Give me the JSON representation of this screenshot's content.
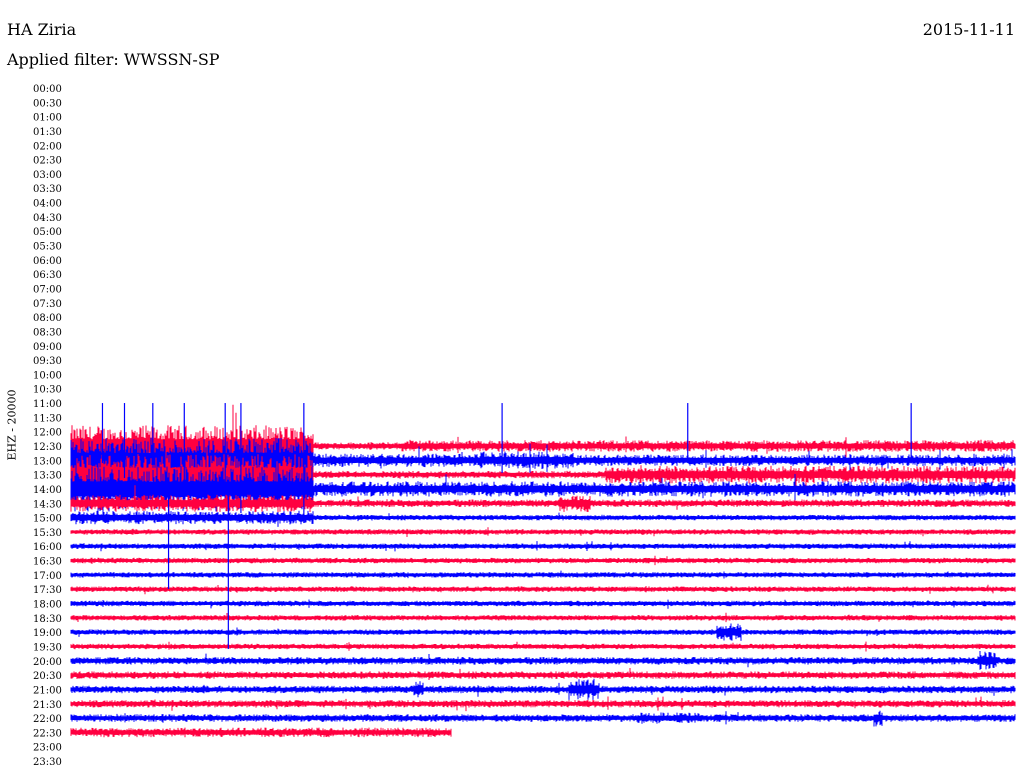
{
  "header": {
    "station": "HA Ziria",
    "filter": "Applied filter: WWSSN-SP",
    "date": "2015-11-11"
  },
  "chart_data": {
    "type": "line",
    "title": "HA Ziria",
    "ylabel": "EHZ - 20000",
    "row_minutes": 30,
    "row_labels": [
      "00:00",
      "00:30",
      "01:00",
      "01:30",
      "02:00",
      "02:30",
      "03:00",
      "03:30",
      "04:00",
      "04:30",
      "05:00",
      "05:30",
      "06:00",
      "06:30",
      "07:00",
      "07:30",
      "08:00",
      "08:30",
      "09:00",
      "09:30",
      "10:00",
      "10:30",
      "11:00",
      "11:30",
      "12:00",
      "12:30",
      "13:00",
      "13:30",
      "14:00",
      "14:30",
      "15:00",
      "15:30",
      "16:00",
      "16:30",
      "17:00",
      "17:30",
      "18:00",
      "18:30",
      "19:00",
      "19:30",
      "20:00",
      "20:30",
      "21:00",
      "21:30",
      "22:00",
      "22:30",
      "23:00",
      "23:30"
    ],
    "colors": {
      "even": "#0000ff",
      "odd": "#ff0040"
    },
    "traces": [
      {
        "row": "12:30",
        "start_min": 0,
        "end_min": 30,
        "noise": 3,
        "burst": [
          [
            0,
            7.7,
            20
          ],
          [
            7.7,
            10.5,
            3
          ],
          [
            10.5,
            30,
            5
          ]
        ]
      },
      {
        "row": "13:00",
        "start_min": 0,
        "end_min": 30,
        "noise": 5,
        "burst": [
          [
            0,
            7.7,
            22
          ],
          [
            7.7,
            13,
            6
          ],
          [
            13,
            16,
            8
          ],
          [
            16,
            30,
            5
          ]
        ]
      },
      {
        "row": "13:30",
        "start_min": 0,
        "end_min": 30,
        "noise": 3,
        "burst": [
          [
            0,
            7.7,
            20
          ],
          [
            17,
            30,
            8
          ]
        ]
      },
      {
        "row": "14:00",
        "start_min": 0,
        "end_min": 30,
        "noise": 5,
        "burst": [
          [
            0,
            7.7,
            22
          ],
          [
            7.7,
            30,
            7
          ]
        ]
      },
      {
        "row": "14:30",
        "start_min": 0,
        "end_min": 30,
        "noise": 3,
        "burst": [
          [
            0,
            7.7,
            8
          ],
          [
            15.5,
            16.5,
            8
          ]
        ]
      },
      {
        "row": "15:00",
        "start_min": 0,
        "end_min": 30,
        "noise": 2,
        "burst": [
          [
            0,
            7.7,
            6
          ]
        ]
      },
      {
        "row": "15:30",
        "start_min": 0,
        "end_min": 30,
        "noise": 2
      },
      {
        "row": "16:00",
        "start_min": 0,
        "end_min": 30,
        "noise": 2
      },
      {
        "row": "16:30",
        "start_min": 0,
        "end_min": 30,
        "noise": 2
      },
      {
        "row": "17:00",
        "start_min": 0,
        "end_min": 30,
        "noise": 2
      },
      {
        "row": "17:30",
        "start_min": 0,
        "end_min": 30,
        "noise": 2
      },
      {
        "row": "18:00",
        "start_min": 0,
        "end_min": 30,
        "noise": 2
      },
      {
        "row": "18:30",
        "start_min": 0,
        "end_min": 30,
        "noise": 2
      },
      {
        "row": "19:00",
        "start_min": 0,
        "end_min": 30,
        "noise": 2,
        "burst": [
          [
            20.5,
            21.3,
            8
          ]
        ]
      },
      {
        "row": "19:30",
        "start_min": 0,
        "end_min": 30,
        "noise": 2
      },
      {
        "row": "20:00",
        "start_min": 0,
        "end_min": 30,
        "noise": 3,
        "burst": [
          [
            28.8,
            29.4,
            9
          ]
        ]
      },
      {
        "row": "20:30",
        "start_min": 0,
        "end_min": 30,
        "noise": 3
      },
      {
        "row": "21:00",
        "start_min": 0,
        "end_min": 30,
        "noise": 3,
        "burst": [
          [
            15.8,
            16.8,
            10
          ],
          [
            10.9,
            11.2,
            8
          ]
        ]
      },
      {
        "row": "21:30",
        "start_min": 0,
        "end_min": 30,
        "noise": 3
      },
      {
        "row": "22:00",
        "start_min": 0,
        "end_min": 30,
        "noise": 3,
        "burst": [
          [
            18,
            20,
            5
          ],
          [
            25.5,
            25.8,
            8
          ]
        ]
      },
      {
        "row": "22:30",
        "start_min": 0,
        "end_min": 12.1,
        "noise": 4
      }
    ],
    "spikes": [
      {
        "row": "11:00",
        "min": 1.0,
        "amp": 60
      },
      {
        "row": "11:00",
        "min": 1.7,
        "amp": 75
      },
      {
        "row": "11:00",
        "min": 3.6,
        "amp": 95
      },
      {
        "row": "11:00",
        "min": 4.9,
        "amp": 80
      },
      {
        "row": "11:00",
        "min": 5.4,
        "amp": 110
      },
      {
        "row": "11:00",
        "min": 7.4,
        "amp": 120
      },
      {
        "row": "11:00",
        "min": 2.6,
        "amp": 50
      },
      {
        "row": "11:00",
        "min": 13.7,
        "amp": 70
      },
      {
        "row": "11:00",
        "min": 19.6,
        "amp": 60
      },
      {
        "row": "11:00",
        "min": 26.7,
        "amp": 60
      },
      {
        "row": "14:00",
        "min": 5.0,
        "amp": 160
      },
      {
        "row": "14:00",
        "min": 3.1,
        "amp": 100
      }
    ]
  }
}
